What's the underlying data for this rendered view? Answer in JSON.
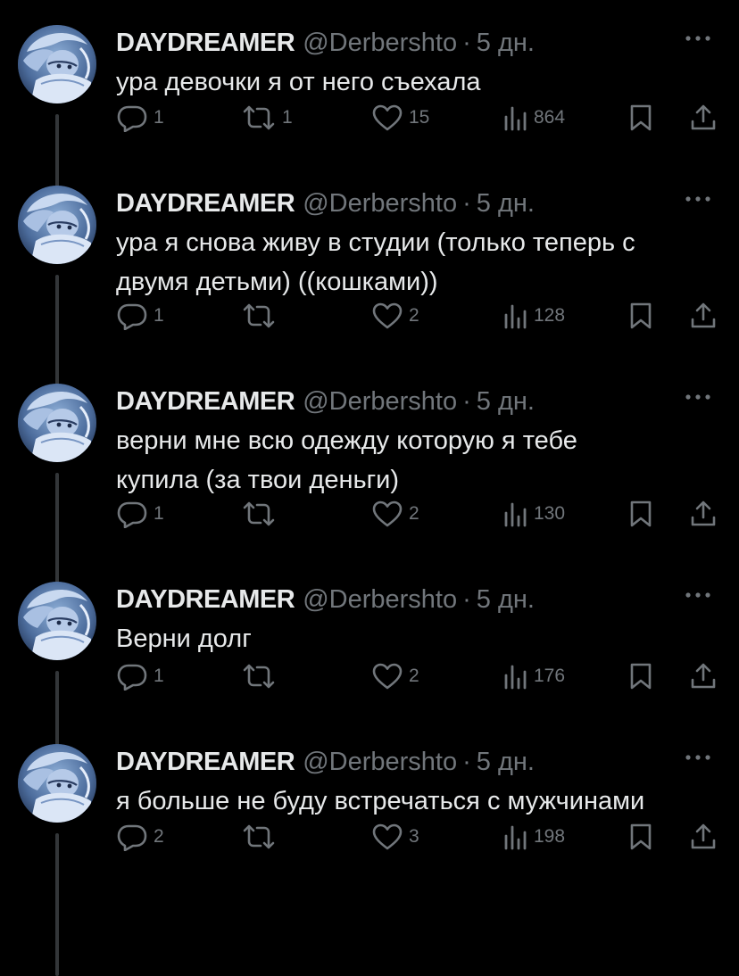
{
  "tweets": [
    {
      "name": "DAYDREAMER",
      "handle": "@Derbershto",
      "separator": "·",
      "time": "5 дн.",
      "text": "ура девочки я от него съехала",
      "replies": "1",
      "retweets": "1",
      "likes": "15",
      "views": "864"
    },
    {
      "name": "DAYDREAMER",
      "handle": "@Derbershto",
      "separator": "·",
      "time": "5 дн.",
      "text": "ура я снова живу в студии (только теперь с\nдвумя детьми) ((кошками))",
      "replies": "1",
      "retweets": "",
      "likes": "2",
      "views": "128"
    },
    {
      "name": "DAYDREAMER",
      "handle": "@Derbershto",
      "separator": "·",
      "time": "5 дн.",
      "text": "верни мне всю одежду которую я тебе\nкупила (за твои деньги)",
      "replies": "1",
      "retweets": "",
      "likes": "2",
      "views": "130"
    },
    {
      "name": "DAYDREAMER",
      "handle": "@Derbershto",
      "separator": "·",
      "time": "5 дн.",
      "text": "Верни долг",
      "replies": "1",
      "retweets": "",
      "likes": "2",
      "views": "176"
    },
    {
      "name": "DAYDREAMER",
      "handle": "@Derbershto",
      "separator": "·",
      "time": "5 дн.",
      "text": "я больше не буду встречаться с мужчинами",
      "replies": "2",
      "retweets": "",
      "likes": "3",
      "views": "198"
    }
  ],
  "icons": {
    "reply": "reply-icon",
    "retweet": "retweet-icon",
    "like": "heart-icon",
    "views": "views-icon",
    "bookmark": "bookmark-icon",
    "share": "share-icon",
    "more": "more-icon",
    "avatar": "avatar"
  },
  "colors": {
    "background": "#000000",
    "text": "#e7e9ea",
    "secondary": "#71767b",
    "thread_line": "#333639"
  }
}
